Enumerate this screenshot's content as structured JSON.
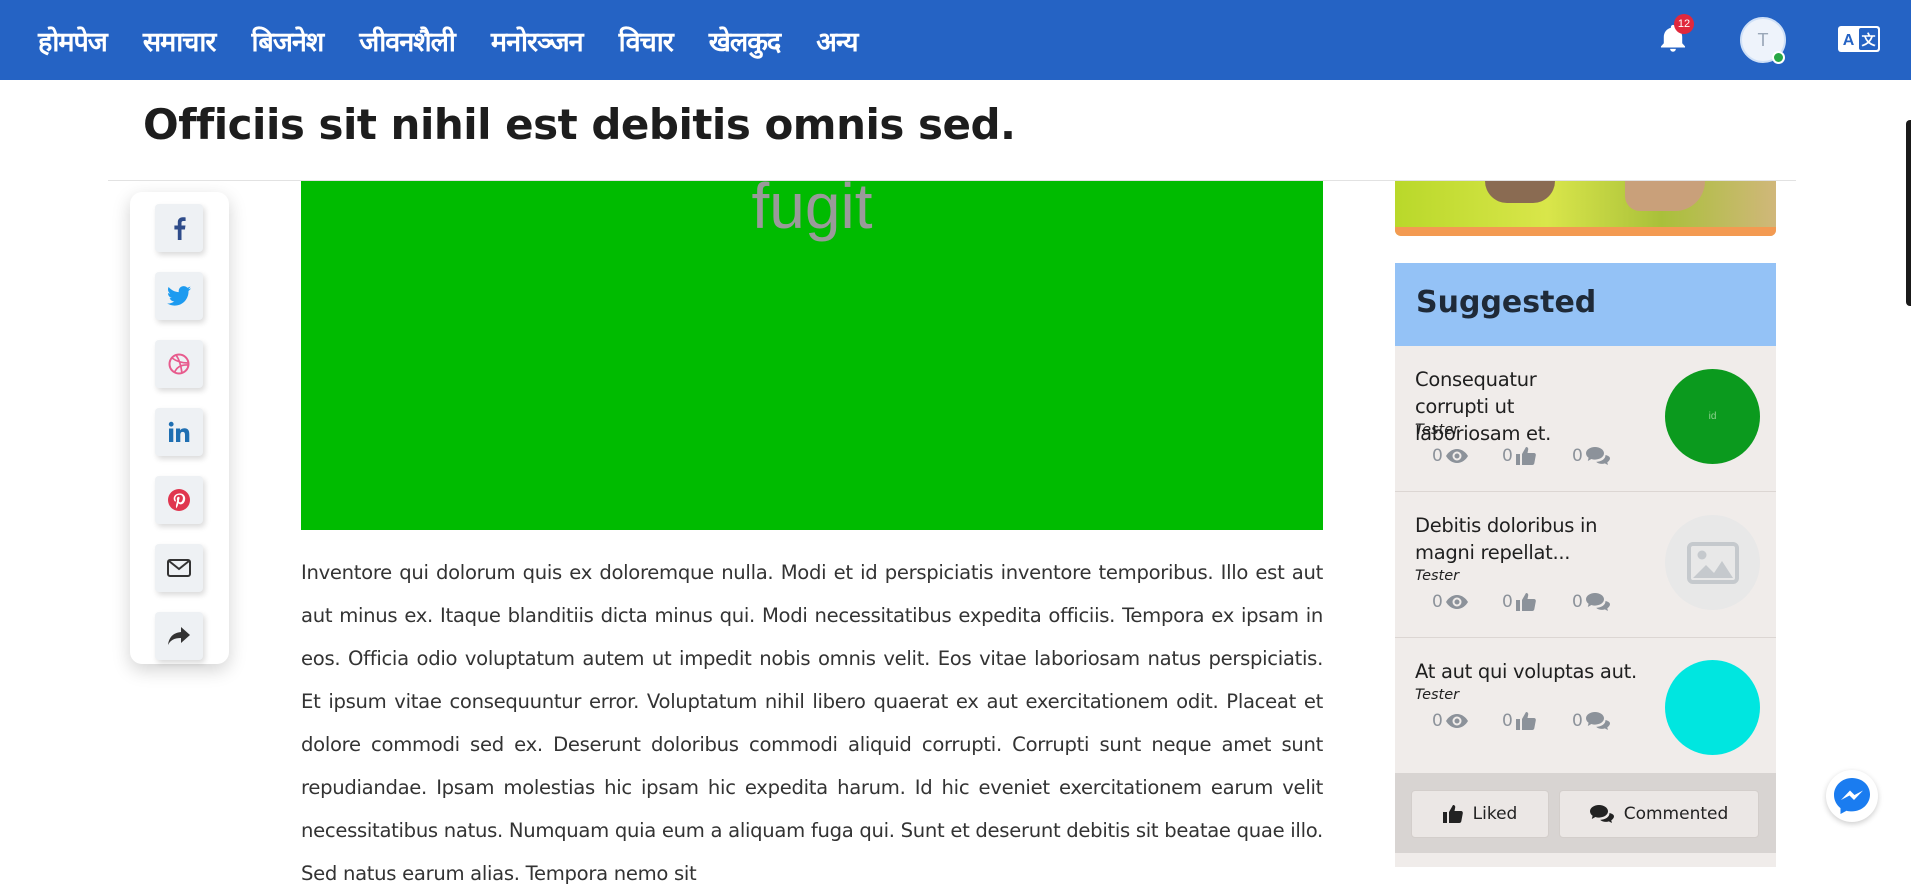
{
  "nav": {
    "items": [
      {
        "label": "होमपेज"
      },
      {
        "label": "समाचार"
      },
      {
        "label": "बिजनेश"
      },
      {
        "label": "जीवनशैली"
      },
      {
        "label": "मनोरञ्जन"
      },
      {
        "label": "विचार"
      },
      {
        "label": "खेलकुद"
      },
      {
        "label": "अन्य"
      }
    ],
    "notification_count": "12",
    "avatar_initial": "T",
    "language_icon": "language-toggle-icon"
  },
  "article": {
    "title": "Officiis sit nihil est debitis omnis sed.",
    "hero_text": "fugit",
    "hero_color": "#00bb00",
    "body": "Inventore qui dolorum quis ex doloremque nulla. Modi et id perspiciatis inventore temporibus. Illo est aut aut minus ex. Itaque blanditiis dicta minus qui. Modi necessitatibus expedita officiis. Tempora ex ipsam in eos. Officia odio voluptatum autem ut impedit nobis omnis velit. Eos vitae laboriosam natus perspiciatis. Et ipsum vitae consequuntur error. Voluptatum nihil libero quaerat ex aut exercitationem odit. Placeat et dolore commodi sed ex. Deserunt doloribus commodi aliquid corrupti. Corrupti sunt neque amet sunt repudiandae. Ipsam molestias hic ipsam hic expedita harum. Id hic eveniet exercitationem earum velit necessitatibus natus. Numquam quia eum a aliquam fuga qui. Sunt et deserunt debitis sit beatae quae illo. Sed natus earum alias. Tempora nemo sit"
  },
  "share": {
    "buttons": [
      "facebook-icon",
      "twitter-icon",
      "dribbble-icon",
      "linkedin-icon",
      "pinterest-icon",
      "email-icon",
      "share-icon"
    ]
  },
  "sidebar": {
    "heading": "Suggested",
    "items": [
      {
        "title": "Consequatur corrupti ut laboriosam et.",
        "author": "Tester",
        "views": "0",
        "likes": "0",
        "comments": "0",
        "thumb_color": "#0b9a1e",
        "thumb_text": "id"
      },
      {
        "title": "Debitis doloribus in magni repellat...",
        "author": "Tester",
        "views": "0",
        "likes": "0",
        "comments": "0",
        "thumb_color": "#e8e8e8",
        "thumb_text": ""
      },
      {
        "title": "At aut qui voluptas aut.",
        "author": "Tester",
        "views": "0",
        "likes": "0",
        "comments": "0",
        "thumb_color": "#00e6e0",
        "thumb_text": ""
      }
    ],
    "tabs": [
      {
        "label": "Liked"
      },
      {
        "label": "Commented"
      }
    ]
  },
  "colors": {
    "nav_bg": "#2563c4",
    "sidebar_head": "#94c2f6",
    "sidebar_bg": "#f0ecea"
  }
}
